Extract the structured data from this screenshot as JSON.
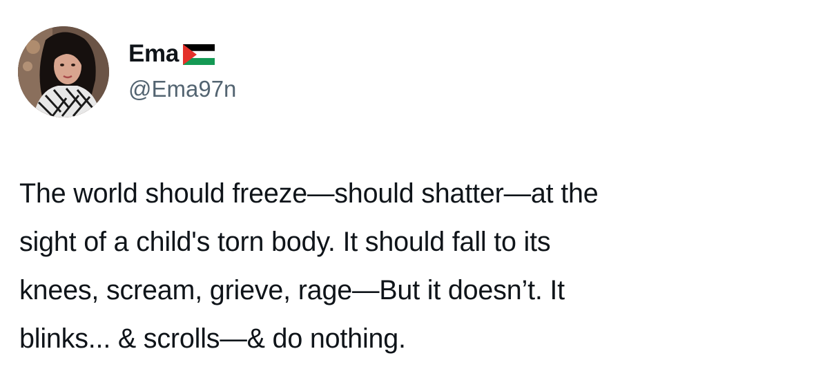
{
  "author": {
    "display_name": "Ema",
    "name_emoji_icon": "palestine-flag-icon",
    "handle": "@Ema97n",
    "avatar_icon": "profile-avatar"
  },
  "tweet": {
    "lines": [
      "The world should freeze—should shatter—at the",
      "sight of a child's torn body. It should fall to its",
      "knees, scream, grieve, rage—But it doesn’t. It",
      "blinks... & scrolls—& do nothing."
    ]
  },
  "colors": {
    "text_primary": "#0f1419",
    "text_secondary": "#536471",
    "background": "#ffffff",
    "flag_black": "#000000",
    "flag_white": "#ffffff",
    "flag_green": "#149954",
    "flag_red": "#e4312b"
  }
}
